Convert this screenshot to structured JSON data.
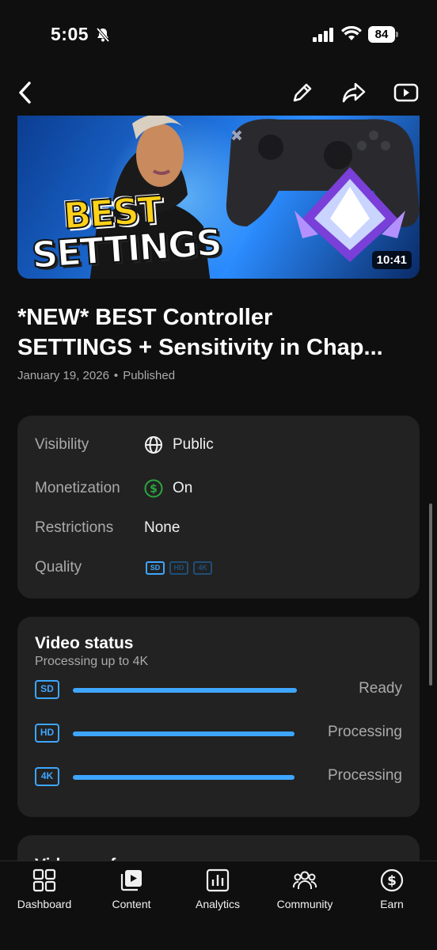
{
  "status_bar": {
    "time": "5:05",
    "battery": "84"
  },
  "video": {
    "thumbnail_text_line1": "BEST",
    "thumbnail_text_line2": "SETTINGS",
    "duration": "10:41",
    "title_line1": "*NEW* BEST Controller",
    "title_line2": "SETTINGS + Sensitivity in Chap...",
    "date": "January 19, 2026",
    "separator": "•",
    "state": "Published"
  },
  "details": {
    "visibility_label": "Visibility",
    "visibility_value": "Public",
    "monetization_label": "Monetization",
    "monetization_value": "On",
    "restrictions_label": "Restrictions",
    "restrictions_value": "None",
    "quality_label": "Quality",
    "quality_badges": [
      "SD",
      "HD",
      "4K"
    ]
  },
  "video_status": {
    "title": "Video status",
    "subtitle": "Processing up to 4K",
    "rows": [
      {
        "badge": "SD",
        "progress_percent": 100,
        "status": "Ready"
      },
      {
        "badge": "HD",
        "progress_percent": 100,
        "status": "Processing"
      },
      {
        "badge": "4K",
        "progress_percent": 100,
        "status": "Processing"
      }
    ]
  },
  "next_card": {
    "title": "Video perf"
  },
  "bottom_nav": [
    {
      "label": "Dashboard",
      "icon": "dashboard-icon"
    },
    {
      "label": "Content",
      "icon": "content-icon"
    },
    {
      "label": "Analytics",
      "icon": "analytics-icon"
    },
    {
      "label": "Community",
      "icon": "community-icon"
    },
    {
      "label": "Earn",
      "icon": "earn-icon"
    }
  ],
  "colors": {
    "accent": "#3ea6ff",
    "monetization": "#2ba640",
    "background": "#0f0f0f",
    "card": "#222222"
  }
}
